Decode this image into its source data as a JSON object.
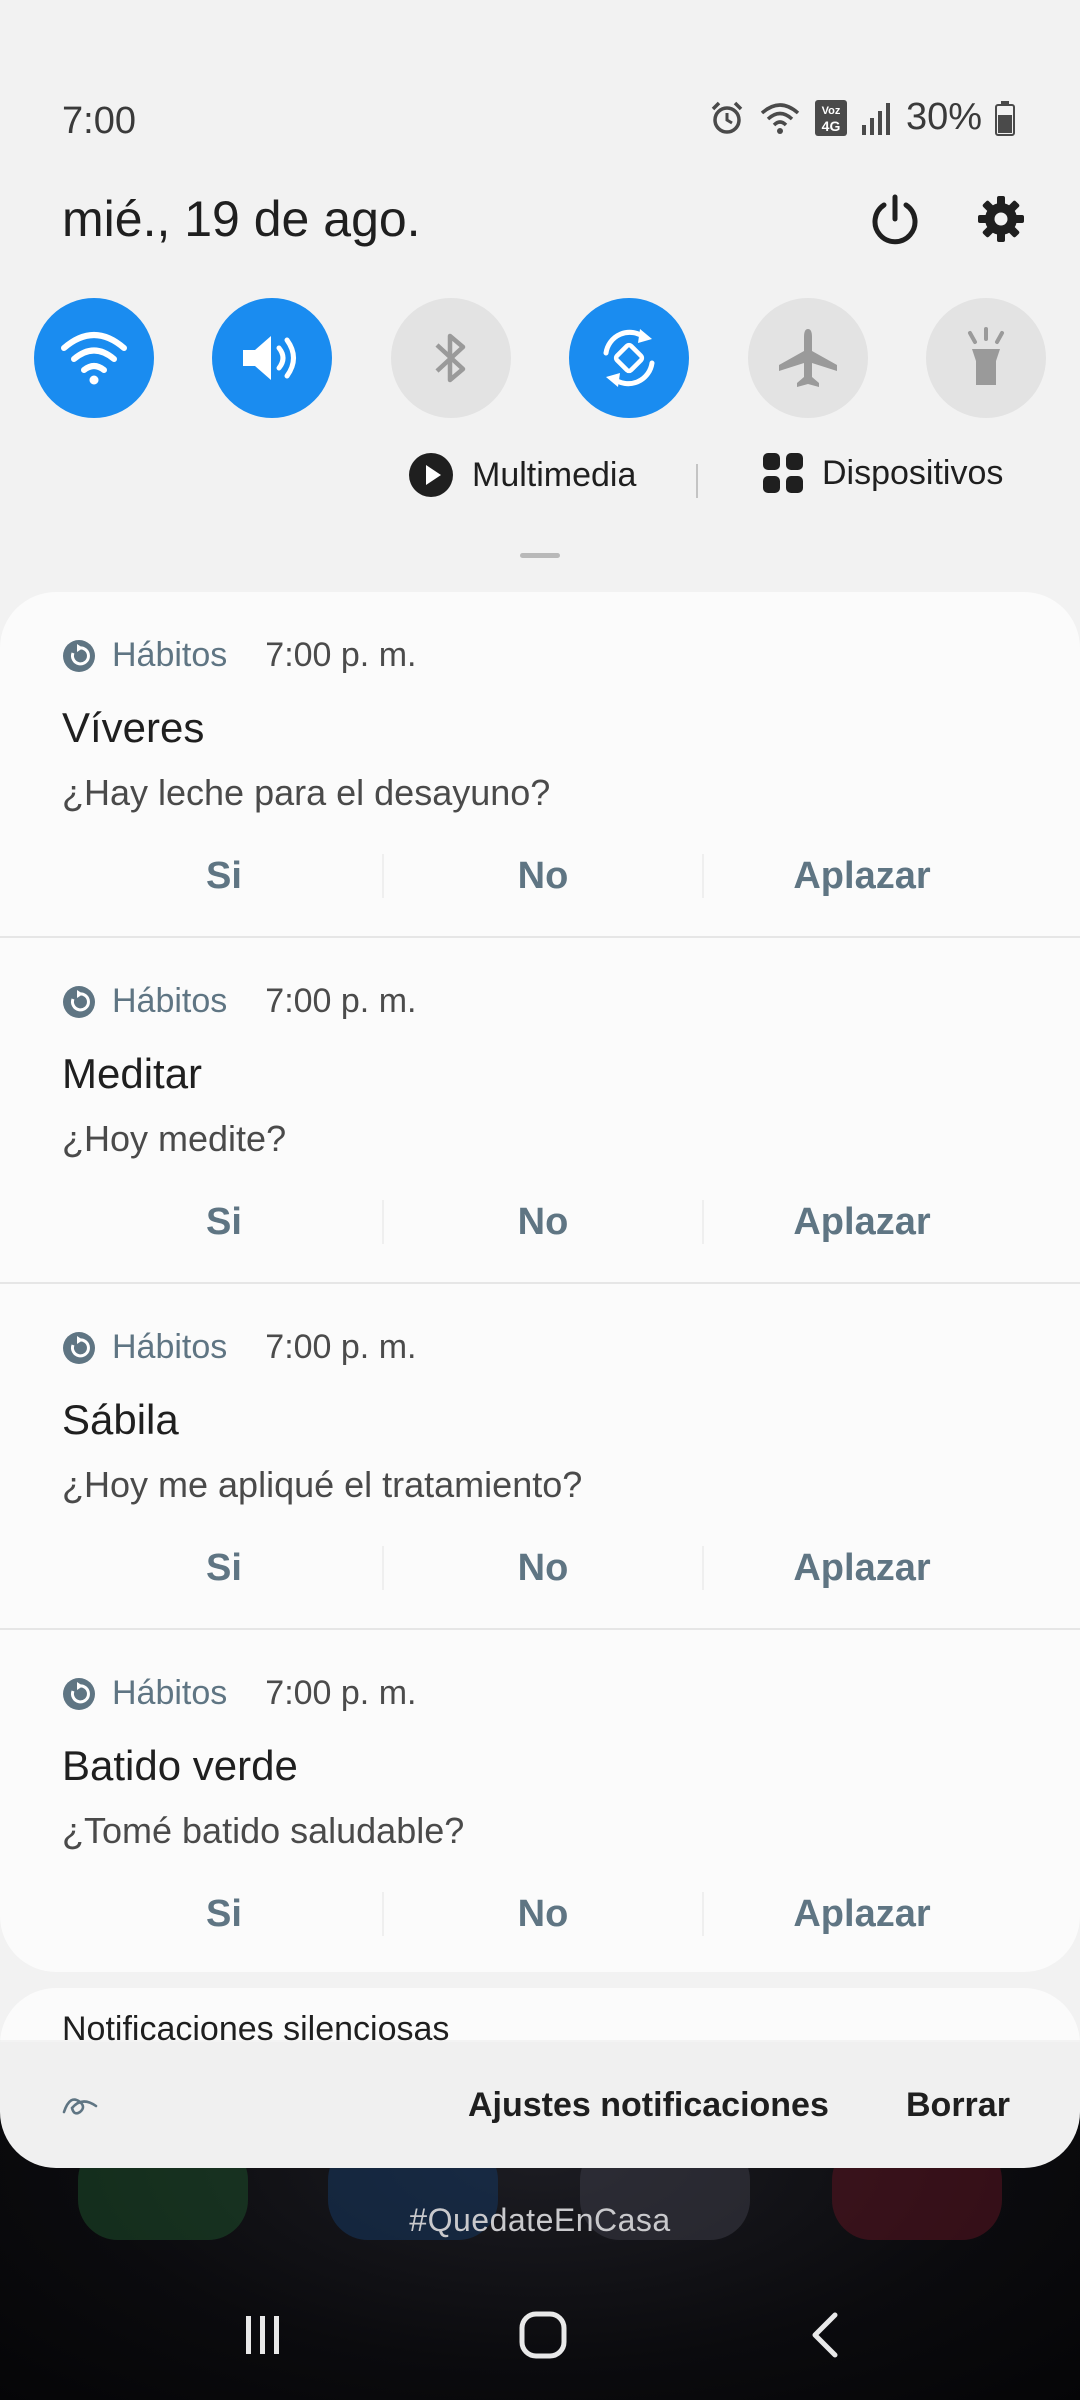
{
  "status_bar": {
    "time": "7:00",
    "battery": "30%",
    "icons": [
      "alarm-icon",
      "wifi-calling-icon",
      "volte-4g-icon",
      "signal-icon",
      "battery-icon"
    ]
  },
  "header": {
    "date": "mié., 19 de ago.",
    "icons": [
      "power-icon",
      "gear-icon"
    ]
  },
  "quick_settings": {
    "toggles": [
      {
        "name": "wifi",
        "state": "on"
      },
      {
        "name": "sound",
        "state": "on"
      },
      {
        "name": "bluetooth",
        "state": "off"
      },
      {
        "name": "auto-rotate",
        "state": "on"
      },
      {
        "name": "airplane-mode",
        "state": "off"
      },
      {
        "name": "flashlight",
        "state": "off"
      }
    ],
    "media_label": "Multimedia",
    "devices_label": "Dispositivos",
    "accent_color": "#1a8cf0"
  },
  "notifications": [
    {
      "app": "Hábitos",
      "time": "7:00 p. m.",
      "title": "Víveres",
      "text": "¿Hay leche para el desayuno?",
      "actions": [
        "Si",
        "No",
        "Aplazar"
      ]
    },
    {
      "app": "Hábitos",
      "time": "7:00 p. m.",
      "title": "Meditar",
      "text": "¿Hoy medite?",
      "actions": [
        "Si",
        "No",
        "Aplazar"
      ]
    },
    {
      "app": "Hábitos",
      "time": "7:00 p. m.",
      "title": "Sábila",
      "text": "¿Hoy me apliqué el tratamiento?",
      "actions": [
        "Si",
        "No",
        "Aplazar"
      ]
    },
    {
      "app": "Hábitos",
      "time": "7:00 p. m.",
      "title": "Batido verde",
      "text": "¿Tomé batido saludable?",
      "actions": [
        "Si",
        "No",
        "Aplazar"
      ]
    }
  ],
  "silent": {
    "title": "Notificaciones silenciosas"
  },
  "bottom_bar": {
    "settings_label": "Ajustes notificaciones",
    "clear_label": "Borrar"
  },
  "wallpaper": {
    "hashtag": "#QuedateEnCasa"
  },
  "nav_bar": {
    "buttons": [
      "recents-icon",
      "home-icon",
      "back-icon"
    ]
  }
}
